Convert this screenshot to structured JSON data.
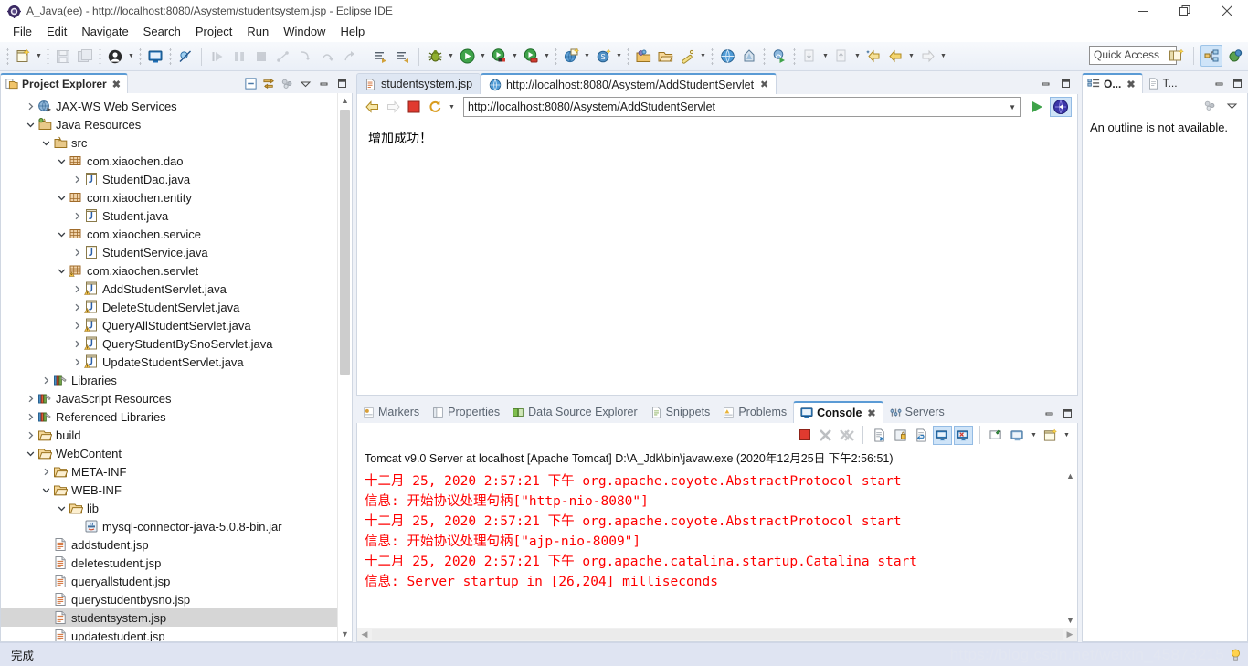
{
  "window": {
    "title": "A_Java(ee) - http://localhost:8080/Asystem/studentsystem.jsp - Eclipse IDE",
    "app_icon": "eclipse-icon",
    "minimize_label": "—",
    "restore_label": "❐",
    "close_label": "✕"
  },
  "menu": {
    "items": [
      {
        "label": "File"
      },
      {
        "label": "Edit"
      },
      {
        "label": "Navigate"
      },
      {
        "label": "Search"
      },
      {
        "label": "Project"
      },
      {
        "label": "Run"
      },
      {
        "label": "Window"
      },
      {
        "label": "Help"
      }
    ]
  },
  "toolbar": {
    "quick_access_placeholder": "Quick Access",
    "quick_access_value": "",
    "buttons": [
      {
        "name": "new-wizard-icon",
        "tooltip": "New"
      },
      {
        "name": "save-icon",
        "tooltip": "Save"
      },
      {
        "name": "save-all-icon",
        "tooltip": "Save All"
      },
      {
        "name": "user-icon",
        "tooltip": "User"
      },
      {
        "name": "terminal-icon",
        "tooltip": "Terminal"
      },
      {
        "name": "skip-breakpoints-icon",
        "tooltip": "Skip All Breakpoints"
      },
      {
        "name": "resume-icon",
        "tooltip": "Resume"
      },
      {
        "name": "suspend-icon",
        "tooltip": "Suspend"
      },
      {
        "name": "terminate-icon",
        "tooltip": "Terminate"
      },
      {
        "name": "disconnect-icon",
        "tooltip": "Disconnect"
      },
      {
        "name": "step-into-icon",
        "tooltip": "Step Into"
      },
      {
        "name": "step-over-icon",
        "tooltip": "Step Over"
      },
      {
        "name": "step-return-icon",
        "tooltip": "Step Return"
      },
      {
        "name": "next-annotation-icon",
        "tooltip": "Next Annotation"
      },
      {
        "name": "previous-annotation-icon",
        "tooltip": "Previous Annotation"
      },
      {
        "name": "debug-icon",
        "tooltip": "Debug"
      },
      {
        "name": "run-icon",
        "tooltip": "Run"
      },
      {
        "name": "run-external-tools-icon",
        "tooltip": "External Tools"
      },
      {
        "name": "run-server-icon",
        "tooltip": "Run on Server"
      },
      {
        "name": "new-web-project-icon",
        "tooltip": "New Dynamic Web Project"
      },
      {
        "name": "new-class-icon",
        "tooltip": "New Java Class"
      },
      {
        "name": "open-type-icon",
        "tooltip": "Open Type"
      },
      {
        "name": "open-task-icon",
        "tooltip": "Open Task"
      },
      {
        "name": "search-icon",
        "tooltip": "Search"
      },
      {
        "name": "web-browser-icon",
        "tooltip": "Web Browser"
      },
      {
        "name": "profile-icon",
        "tooltip": "Profile"
      },
      {
        "name": "run-last-tool-icon",
        "tooltip": "Run Last Tool"
      },
      {
        "name": "previous-edit-icon",
        "tooltip": "Previous Edit Location"
      },
      {
        "name": "next-edit-icon",
        "tooltip": "Next Edit Location"
      },
      {
        "name": "back-icon",
        "tooltip": "Back"
      },
      {
        "name": "forward-icon",
        "tooltip": "Forward"
      }
    ],
    "perspective": {
      "open_perspective": "open-perspective-icon",
      "java_ee_perspective": "java-ee-perspective-icon",
      "java_perspective": "java-perspective-icon"
    }
  },
  "project_explorer": {
    "tab_label": "Project Explorer",
    "tab_icon": "project-explorer-icon",
    "tab_close": "✖",
    "tools": [
      {
        "name": "collapse-all-icon"
      },
      {
        "name": "link-with-editor-icon"
      },
      {
        "name": "view-menu-filters-icon"
      },
      {
        "name": "view-menu-icon"
      },
      {
        "name": "minimize-icon"
      },
      {
        "name": "maximize-icon"
      }
    ],
    "tree": [
      {
        "indent": 1,
        "twist": "collapsed",
        "icon": "jaxws-icon",
        "label": "JAX-WS Web Services"
      },
      {
        "indent": 1,
        "twist": "expanded",
        "icon": "java-res-icon",
        "label": "Java Resources"
      },
      {
        "indent": 2,
        "twist": "expanded",
        "icon": "src-folder-icon",
        "label": "src"
      },
      {
        "indent": 3,
        "twist": "expanded",
        "icon": "package-icon",
        "label": "com.xiaochen.dao"
      },
      {
        "indent": 4,
        "twist": "collapsed",
        "icon": "java-file-icon",
        "label": "StudentDao.java"
      },
      {
        "indent": 3,
        "twist": "expanded",
        "icon": "package-icon",
        "label": "com.xiaochen.entity"
      },
      {
        "indent": 4,
        "twist": "collapsed",
        "icon": "java-file-icon",
        "label": "Student.java"
      },
      {
        "indent": 3,
        "twist": "expanded",
        "icon": "package-icon",
        "label": "com.xiaochen.service"
      },
      {
        "indent": 4,
        "twist": "collapsed",
        "icon": "java-file-icon",
        "label": "StudentService.java"
      },
      {
        "indent": 3,
        "twist": "expanded",
        "icon": "package-warn-icon",
        "label": "com.xiaochen.servlet"
      },
      {
        "indent": 4,
        "twist": "collapsed",
        "icon": "java-warn-icon",
        "label": "AddStudentServlet.java"
      },
      {
        "indent": 4,
        "twist": "collapsed",
        "icon": "java-warn-icon",
        "label": "DeleteStudentServlet.java"
      },
      {
        "indent": 4,
        "twist": "collapsed",
        "icon": "java-warn-icon",
        "label": "QueryAllStudentServlet.java"
      },
      {
        "indent": 4,
        "twist": "collapsed",
        "icon": "java-warn-icon",
        "label": "QueryStudentBySnoServlet.java"
      },
      {
        "indent": 4,
        "twist": "collapsed",
        "icon": "java-warn-icon",
        "label": "UpdateStudentServlet.java"
      },
      {
        "indent": 2,
        "twist": "collapsed",
        "icon": "library-icon",
        "label": "Libraries"
      },
      {
        "indent": 1,
        "twist": "collapsed",
        "icon": "library-icon",
        "label": "JavaScript Resources"
      },
      {
        "indent": 1,
        "twist": "collapsed",
        "icon": "library-icon",
        "label": "Referenced Libraries"
      },
      {
        "indent": 1,
        "twist": "collapsed",
        "icon": "folder-icon",
        "label": "build"
      },
      {
        "indent": 1,
        "twist": "expanded",
        "icon": "folder-icon",
        "label": "WebContent"
      },
      {
        "indent": 2,
        "twist": "collapsed",
        "icon": "folder-icon",
        "label": "META-INF"
      },
      {
        "indent": 2,
        "twist": "expanded",
        "icon": "folder-icon",
        "label": "WEB-INF"
      },
      {
        "indent": 3,
        "twist": "expanded",
        "icon": "folder-icon",
        "label": "lib"
      },
      {
        "indent": 4,
        "twist": "none",
        "icon": "jar-icon",
        "label": "mysql-connector-java-5.0.8-bin.jar"
      },
      {
        "indent": 2,
        "twist": "none",
        "icon": "jsp-icon",
        "label": "addstudent.jsp"
      },
      {
        "indent": 2,
        "twist": "none",
        "icon": "jsp-icon",
        "label": "deletestudent.jsp"
      },
      {
        "indent": 2,
        "twist": "none",
        "icon": "jsp-icon",
        "label": "queryallstudent.jsp"
      },
      {
        "indent": 2,
        "twist": "none",
        "icon": "jsp-icon",
        "label": "querystudentbysno.jsp"
      },
      {
        "indent": 2,
        "twist": "none",
        "icon": "jsp-icon",
        "label": "studentsystem.jsp",
        "selected": true
      },
      {
        "indent": 2,
        "twist": "none",
        "icon": "jsp-icon",
        "label": "updatestudent.jsp"
      }
    ]
  },
  "editor": {
    "tabs": [
      {
        "label": "studentsystem.jsp",
        "icon": "jsp-icon",
        "active": false,
        "closeable": false
      },
      {
        "label": "http://localhost:8080/Asystem/AddStudentServlet",
        "icon": "globe-icon",
        "active": true,
        "closeable": true,
        "close": "✖"
      }
    ],
    "controls": [
      {
        "name": "minimize-icon"
      },
      {
        "name": "maximize-icon"
      }
    ],
    "browser": {
      "back_icon": "back-arrow-icon",
      "forward_icon": "forward-arrow-icon",
      "stop_icon": "stop-icon",
      "refresh_icon": "refresh-icon",
      "dropdown_icon": "chevron-down-icon",
      "url": "http://localhost:8080/Asystem/AddStudentServlet",
      "url_placeholder": "",
      "go_icon": "go-play-icon",
      "open_external_icon": "open-external-browser-icon",
      "page_content": "增加成功！"
    }
  },
  "outline": {
    "tabs": [
      {
        "label": "O...",
        "icon": "outline-icon",
        "active": true,
        "close": "✖"
      },
      {
        "label": "T...",
        "icon": "task-list-icon",
        "active": false
      }
    ],
    "controls": [
      {
        "name": "minimize-icon"
      },
      {
        "name": "maximize-icon"
      }
    ],
    "tools": [
      {
        "name": "view-menu-filters-icon"
      },
      {
        "name": "view-menu-icon"
      }
    ],
    "message": "An outline is not available."
  },
  "console": {
    "tabs": [
      {
        "label": "Markers",
        "icon": "markers-icon",
        "active": false
      },
      {
        "label": "Properties",
        "icon": "properties-icon",
        "active": false
      },
      {
        "label": "Data Source Explorer",
        "icon": "data-source-icon",
        "active": false
      },
      {
        "label": "Snippets",
        "icon": "snippets-icon",
        "active": false
      },
      {
        "label": "Problems",
        "icon": "problems-icon",
        "active": false
      },
      {
        "label": "Console",
        "icon": "console-icon",
        "active": true,
        "close": "✖"
      },
      {
        "label": "Servers",
        "icon": "servers-icon",
        "active": false
      }
    ],
    "controls": [
      {
        "name": "minimize-icon"
      },
      {
        "name": "maximize-icon"
      }
    ],
    "toolbar": [
      {
        "name": "terminate-icon",
        "toggled": false
      },
      {
        "name": "remove-launch-icon",
        "toggled": false
      },
      {
        "name": "remove-all-terminated-icon",
        "toggled": false
      },
      {
        "name": "clear-console-icon",
        "toggled": false
      },
      {
        "name": "scroll-lock-icon",
        "toggled": false
      },
      {
        "name": "word-wrap-icon",
        "toggled": false
      },
      {
        "name": "show-console-on-output-icon",
        "toggled": true
      },
      {
        "name": "show-console-on-error-icon",
        "toggled": true
      },
      {
        "name": "pin-console-icon",
        "toggled": false
      },
      {
        "name": "display-selected-console-icon",
        "toggled": false
      },
      {
        "name": "chevron-down-icon",
        "toggled": false
      },
      {
        "name": "open-console-icon",
        "toggled": false
      },
      {
        "name": "chevron-down-icon-2",
        "toggled": false
      }
    ],
    "header": "Tomcat v9.0 Server at localhost [Apache Tomcat] D:\\A_Jdk\\bin\\javaw.exe (2020年12月25日 下午2:56:51)",
    "lines": [
      "十二月 25, 2020 2:57:21 下午 org.apache.coyote.AbstractProtocol start",
      "信息: 开始协议处理句柄[\"http-nio-8080\"]",
      "十二月 25, 2020 2:57:21 下午 org.apache.coyote.AbstractProtocol start",
      "信息: 开始协议处理句柄[\"ajp-nio-8009\"]",
      "十二月 25, 2020 2:57:21 下午 org.apache.catalina.startup.Catalina start",
      "信息: Server startup in [26,204] milliseconds"
    ],
    "text_color": "#ff0000"
  },
  "statusbar": {
    "message": "完成",
    "watermark": "https://blog.csdn.net/weixin_45873215",
    "bulb_icon": "tip-bulb-icon"
  }
}
